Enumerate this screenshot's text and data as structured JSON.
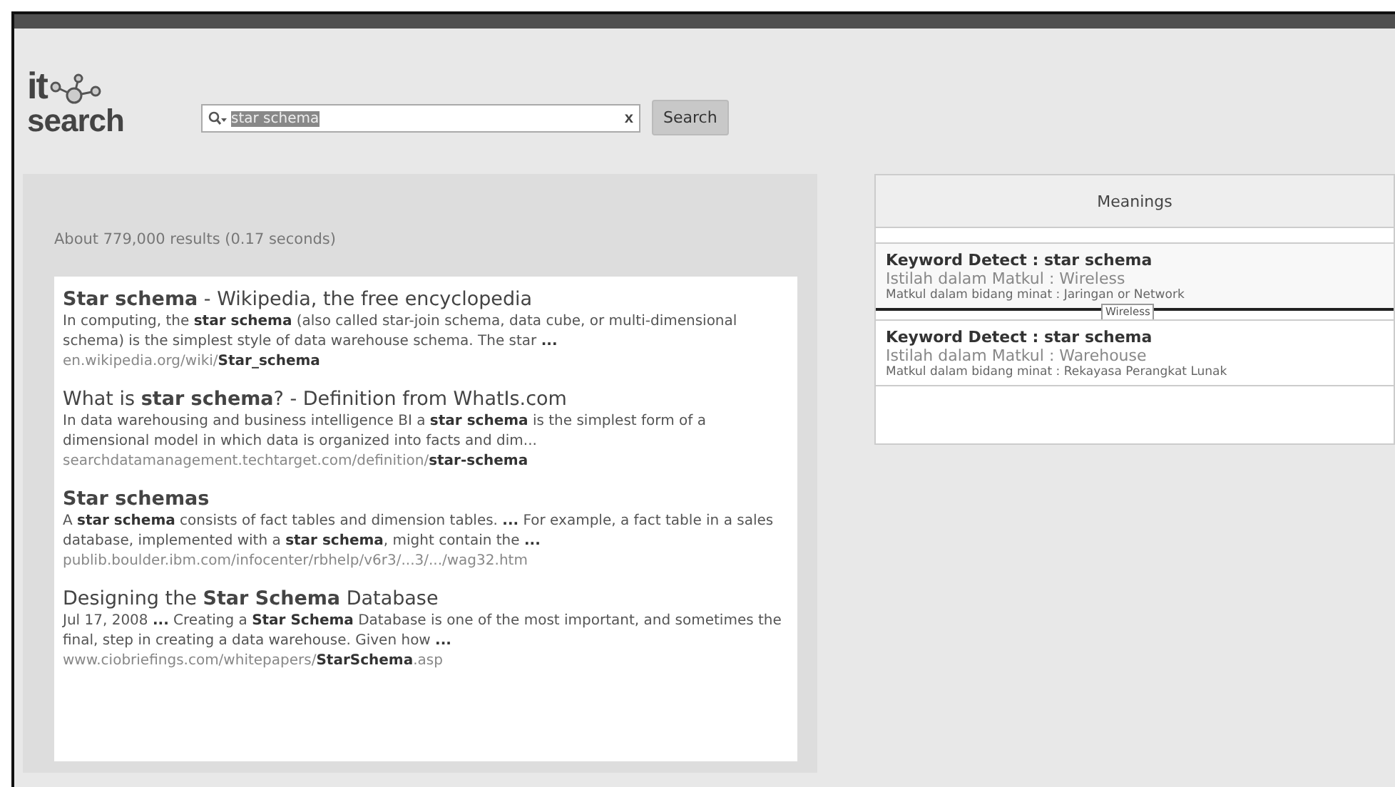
{
  "logo": {
    "top": "it",
    "bottom": "search"
  },
  "search": {
    "value": "star schema",
    "selected": true,
    "clear": "x",
    "button": "Search"
  },
  "results": {
    "stats": "About 779,000 results (0.17 seconds)",
    "items": [
      {
        "title": "**Star schema** - Wikipedia, the free encyclopedia",
        "snippet": "In computing, the **star schema** (also called star-join schema, data cube, or multi-dimensional schema) is the simplest style of data warehouse schema. The star **...**",
        "url": "en.wikipedia.org/wiki/**Star_schema**"
      },
      {
        "title": "What is **star schema**? - Definition from WhatIs.com",
        "snippet": "In data warehousing and business intelligence BI a **star schema** is the simplest form of a dimensional model in which data is organized into facts and dim...",
        "url": "searchdatamanagement.techtarget.com/definition/**star-schema**"
      },
      {
        "title": "**Star schemas**",
        "snippet": "A **star schema** consists of fact tables and dimension tables. **...** For example, a fact table in a sales database, implemented with a **star schema**, might contain the **...**",
        "url": "publib.boulder.ibm.com/infocenter/rbhelp/v6r3/...3/.../wag32.htm"
      },
      {
        "title": "Designing the **Star Schema** Database",
        "snippet": "Jul 17, 2008 **...** Creating a **Star Schema** Database is one of the most important, and sometimes the final, step in creating a data warehouse. Given how **...**",
        "url": "www.ciobriefings.com/whitepapers/**StarSchema**.asp"
      }
    ]
  },
  "meanings": {
    "title": "Meanings",
    "items": [
      {
        "keyword": "Keyword Detect : star schema",
        "term": "Istilah dalam Matkul : Wireless",
        "field": "Matkul dalam bidang minat : Jaringan or Network",
        "tooltip": "Wireless"
      },
      {
        "keyword": "Keyword Detect : star schema",
        "term": "Istilah dalam Matkul : Warehouse",
        "field": "Matkul dalam bidang minat : Rekayasa Perangkat Lunak"
      }
    ]
  }
}
